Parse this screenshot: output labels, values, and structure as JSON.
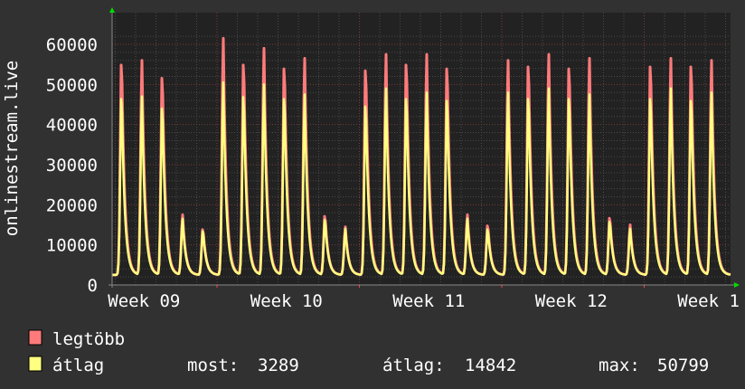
{
  "chart_data": {
    "type": "line",
    "ylabel": "onlinestream.live",
    "ylim": [
      0,
      60000
    ],
    "yticks": [
      "0",
      "10000",
      "20000",
      "30000",
      "40000",
      "50000",
      "60000"
    ],
    "xticks": [
      "Week 09",
      "Week 10",
      "Week 11",
      "Week 12",
      "Week 1"
    ],
    "grid": true,
    "legend_position": "bottom-left",
    "daily_trough": 2500,
    "series": [
      {
        "name": "legtöbb",
        "color": "#ff7b7b",
        "daily_peaks": [
          58000,
          56000,
          54500,
          17500,
          14500,
          61500,
          58000,
          59000,
          57000,
          56500,
          18000,
          14500,
          56500,
          57500,
          58000,
          57500,
          57000,
          17500,
          15500,
          56000,
          57500,
          57500,
          57000,
          56500,
          17500,
          15000,
          57500,
          56500,
          57500,
          56000
        ]
      },
      {
        "name": "átlag",
        "color": "#ffff80",
        "daily_peaks": [
          49000,
          47000,
          46500,
          16500,
          14000,
          50500,
          49500,
          50000,
          49000,
          47500,
          17000,
          14000,
          47000,
          49000,
          49000,
          48000,
          48500,
          16500,
          14500,
          48000,
          49000,
          49000,
          49000,
          47500,
          16500,
          14000,
          49000,
          49000,
          48500,
          48000
        ]
      }
    ],
    "stats": {
      "most_label": "most:",
      "most": "3289",
      "avg_label": "átlag:",
      "avg": "14842",
      "max_label": "max:",
      "max": "50799"
    }
  }
}
